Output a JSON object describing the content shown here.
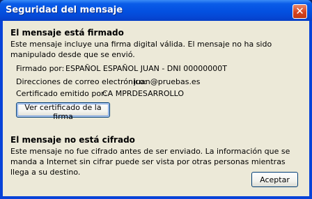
{
  "window": {
    "title": "Seguridad del mensaje",
    "close_glyph": "✕"
  },
  "signed": {
    "heading": "El mensaje está firmado",
    "description": "Este mensaje incluye una firma digital válida. El mensaje no ha sido manipulado desde que se envió.",
    "fields": [
      {
        "label": "Firmado por:",
        "value": "ESPAÑOL ESPAÑOL JUAN - DNI 00000000T"
      },
      {
        "label": "Direcciones de correo electrónico:",
        "value": "juan@pruebas.es"
      },
      {
        "label": "Certificado emitido por:",
        "value": "CA MPRDESARROLLO"
      }
    ],
    "view_cert_button": "Ver certificado de la firma"
  },
  "encrypted": {
    "heading": "El mensaje no está cifrado",
    "description": "Este mensaje no fue cifrado antes de ser enviado. La información que se manda a Internet sin cifrar puede ser vista por otras personas mientras llega a su destino."
  },
  "buttons": {
    "accept": "Aceptar"
  }
}
